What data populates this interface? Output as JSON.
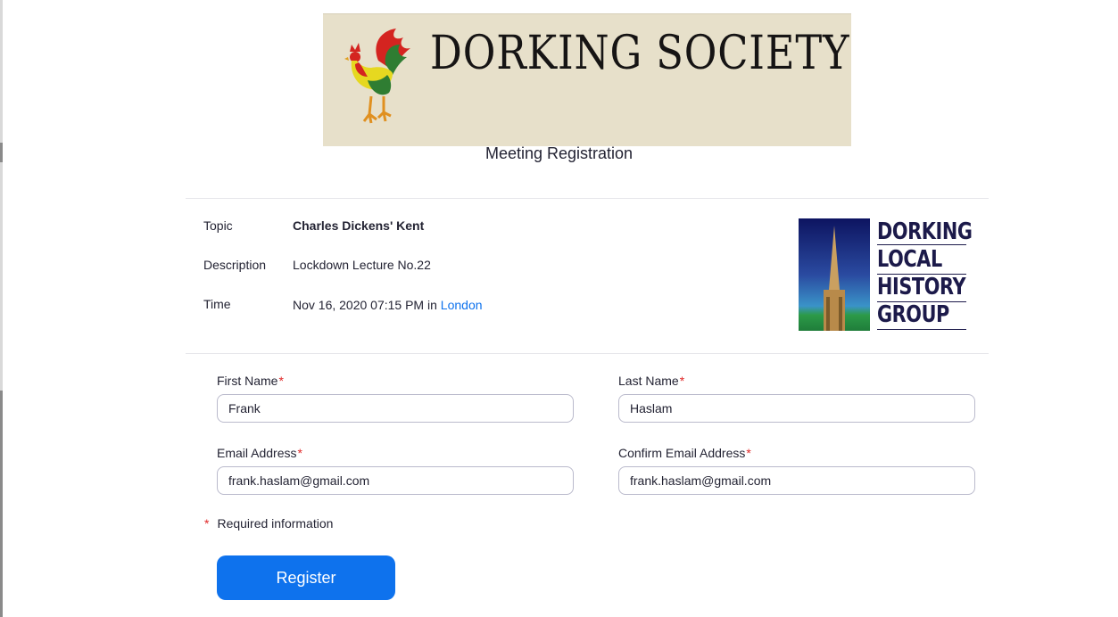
{
  "banner": {
    "title": "DORKING SOCIETY"
  },
  "page": {
    "title": "Meeting Registration"
  },
  "meeting": {
    "topic_label": "Topic",
    "topic": "Charles Dickens' Kent",
    "description_label": "Description",
    "description": "Lockdown Lecture No.22",
    "time_label": "Time",
    "time": "Nov 16, 2020 07:15 PM",
    "time_in": "in",
    "timezone": "London"
  },
  "logo": {
    "words": [
      "DORKING",
      "LOCAL",
      "HISTORY",
      "GROUP"
    ]
  },
  "form": {
    "first_name_label": "First Name",
    "first_name_value": "Frank",
    "last_name_label": "Last Name",
    "last_name_value": "Haslam",
    "email_label": "Email Address",
    "email_value": "frank.haslam@gmail.com",
    "confirm_email_label": "Confirm Email Address",
    "confirm_email_value": "frank.haslam@gmail.com",
    "required_mark": "*",
    "required_note": "Required information",
    "register_label": "Register"
  },
  "colors": {
    "accent": "#0e72ed",
    "required": "#e02828",
    "banner_bg": "#e7e0ca"
  }
}
